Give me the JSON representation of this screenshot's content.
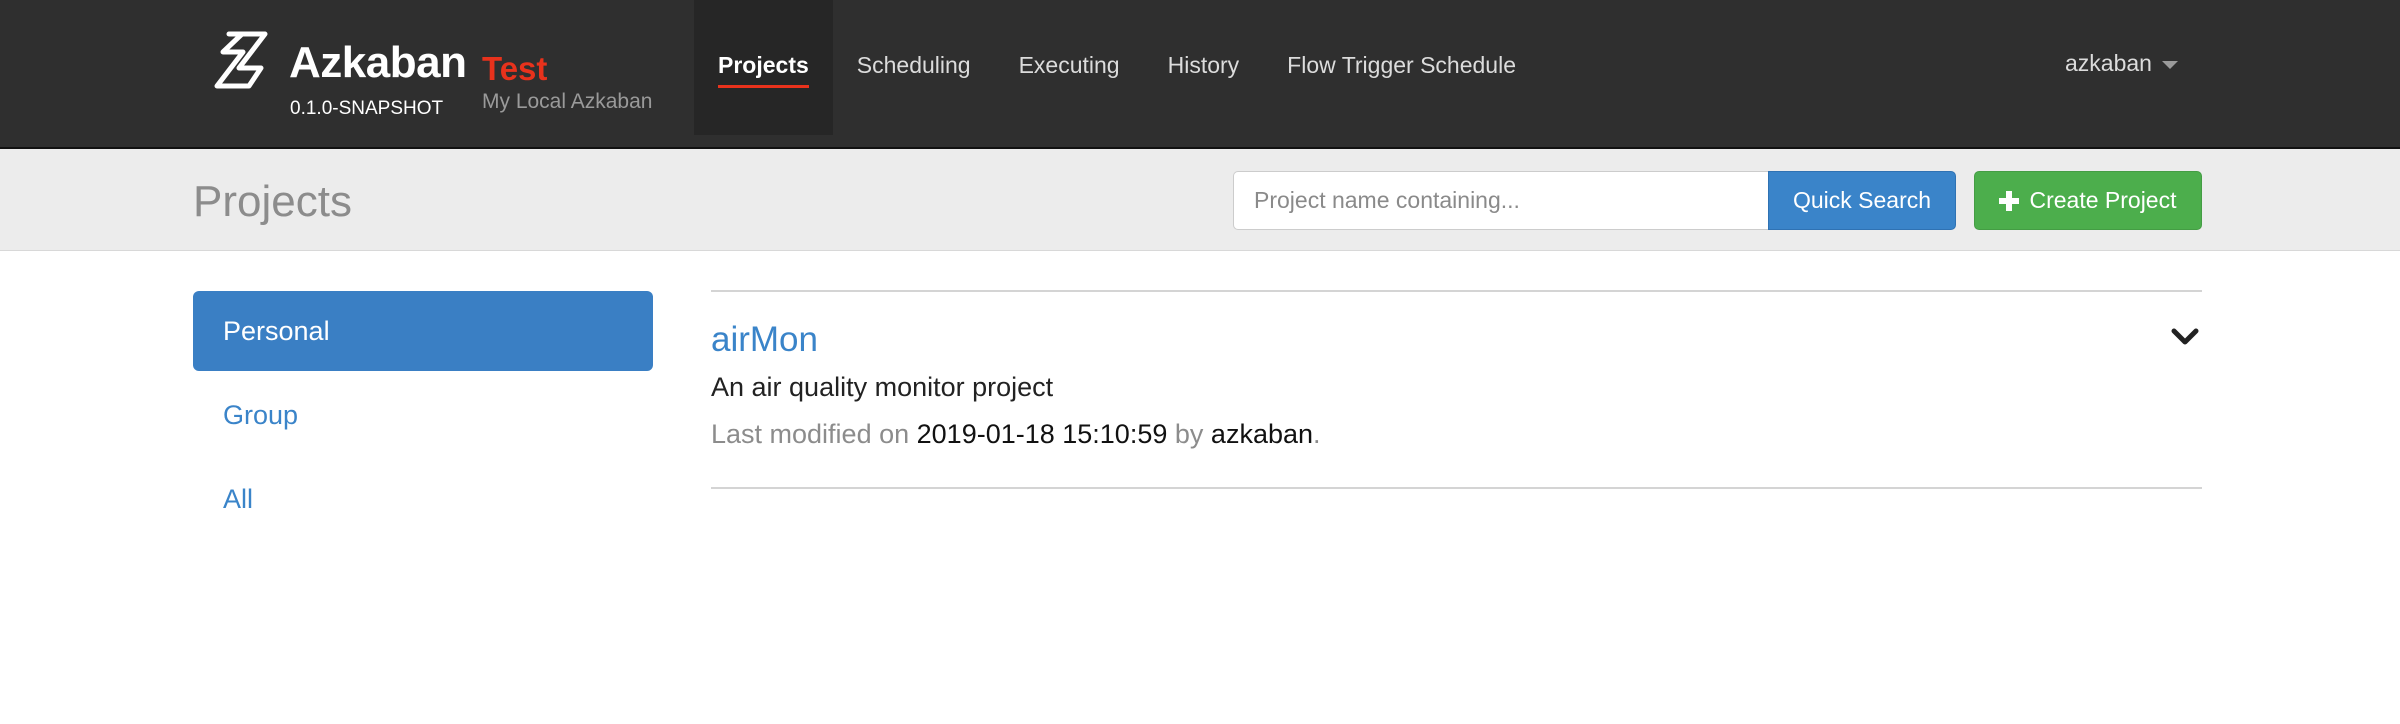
{
  "brand": {
    "name": "Azkaban",
    "env": "Test",
    "version": "0.1.0-SNAPSHOT",
    "description": "My Local Azkaban"
  },
  "nav": {
    "items": [
      {
        "label": "Projects",
        "active": true
      },
      {
        "label": "Scheduling"
      },
      {
        "label": "Executing"
      },
      {
        "label": "History"
      },
      {
        "label": "Flow Trigger Schedule"
      }
    ],
    "user": "azkaban"
  },
  "header": {
    "title": "Projects",
    "search_placeholder": "Project name containing...",
    "search_value": "",
    "quick_search_label": "Quick Search",
    "create_project_label": "Create Project"
  },
  "sidebar": {
    "items": [
      {
        "label": "Personal",
        "active": true
      },
      {
        "label": "Group"
      },
      {
        "label": "All"
      }
    ]
  },
  "projects": [
    {
      "name": "airMon",
      "description": "An air quality monitor project",
      "modified_prefix": "Last modified on",
      "modified_date": "2019-01-18 15:10:59",
      "by_label": "by",
      "modified_by": "azkaban",
      "suffix": "."
    }
  ],
  "colors": {
    "navbar_bg": "#2f2f2f",
    "accent_red": "#e8321c",
    "primary_blue": "#3a84c9",
    "success_green": "#4cae4c",
    "header_bg": "#ececec"
  },
  "icons": {
    "logo": "azkaban-logo",
    "user_caret": "caret-down-icon",
    "create": "plus-icon",
    "expand": "chevron-down-icon"
  }
}
